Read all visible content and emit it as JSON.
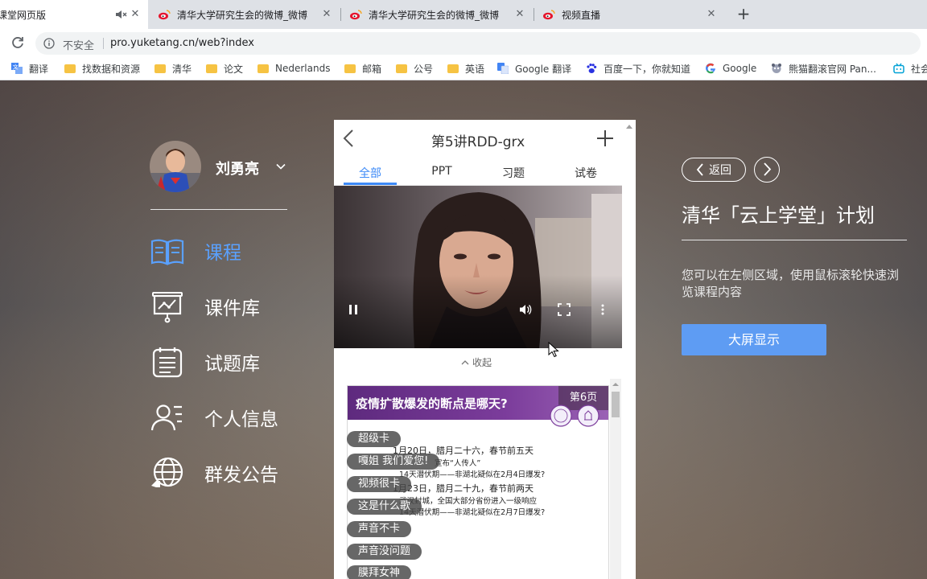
{
  "browser": {
    "tabs": [
      {
        "title": "课堂网页版",
        "muted": true
      },
      {
        "title": "清华大学研究生会的微博_微博"
      },
      {
        "title": "清华大学研究生会的微博_微博"
      },
      {
        "title": "视频直播"
      }
    ],
    "address": {
      "security_label": "不安全",
      "url": "pro.yuketang.cn/web?index"
    },
    "bookmarks": [
      {
        "label": "翻译",
        "icon": "translate-icon"
      },
      {
        "label": "找数据和资源",
        "icon": "folder-icon"
      },
      {
        "label": "清华",
        "icon": "folder-icon"
      },
      {
        "label": "论文",
        "icon": "folder-icon"
      },
      {
        "label": "Nederlands",
        "icon": "folder-icon"
      },
      {
        "label": "邮箱",
        "icon": "folder-icon"
      },
      {
        "label": "公号",
        "icon": "folder-icon"
      },
      {
        "label": "英语",
        "icon": "folder-icon"
      },
      {
        "label": "Google 翻译",
        "icon": "google-translate-icon"
      },
      {
        "label": "百度一下，你就知道",
        "icon": "baidu-paw-icon"
      },
      {
        "label": "Google",
        "icon": "google-icon"
      },
      {
        "label": "熊猫翻滚官网 Pan...",
        "icon": "panda-icon"
      },
      {
        "label": "社会",
        "icon": "bilibili-icon"
      }
    ]
  },
  "user": {
    "name": "刘勇亮"
  },
  "nav": [
    {
      "label": "课程",
      "icon": "course-book-icon",
      "active": true
    },
    {
      "label": "课件库",
      "icon": "courseware-board-icon"
    },
    {
      "label": "试题库",
      "icon": "question-bank-icon"
    },
    {
      "label": "个人信息",
      "icon": "profile-icon"
    },
    {
      "label": "群发公告",
      "icon": "broadcast-globe-icon"
    }
  ],
  "phone": {
    "title": "第5讲RDD-grx",
    "tabs": [
      "全部",
      "PPT",
      "习题",
      "试卷"
    ],
    "active_tab": "全部",
    "collapse_label": "收起",
    "slide": {
      "title": "疫情扩散爆发的断点是哪天?",
      "page_label": "第6页",
      "lines": [
        "1月20日，腊月二十六，春节前五天",
        "宣布“人传人”",
        "14天潜伏期——非湖北疑似在2月4日爆发?",
        "1月23日，腊月二十九，春节前两天",
        "武汉封城，全国大部分省份进入一级响应",
        "14天潜伏期——非湖北疑似在2月7日爆发?"
      ]
    },
    "danmaku": [
      "超级卡",
      "嘎姐 我们爱您!",
      "视频很卡",
      "这是什么歌",
      "声音不卡",
      "声音没问题",
      "膜拜女神"
    ]
  },
  "right_panel": {
    "back_label": "返回",
    "title": "清华「云上学堂」计划",
    "description": "您可以在左侧区域，使用鼠标滚轮快速浏览课程内容",
    "fullscreen_button": "大屏显示"
  }
}
